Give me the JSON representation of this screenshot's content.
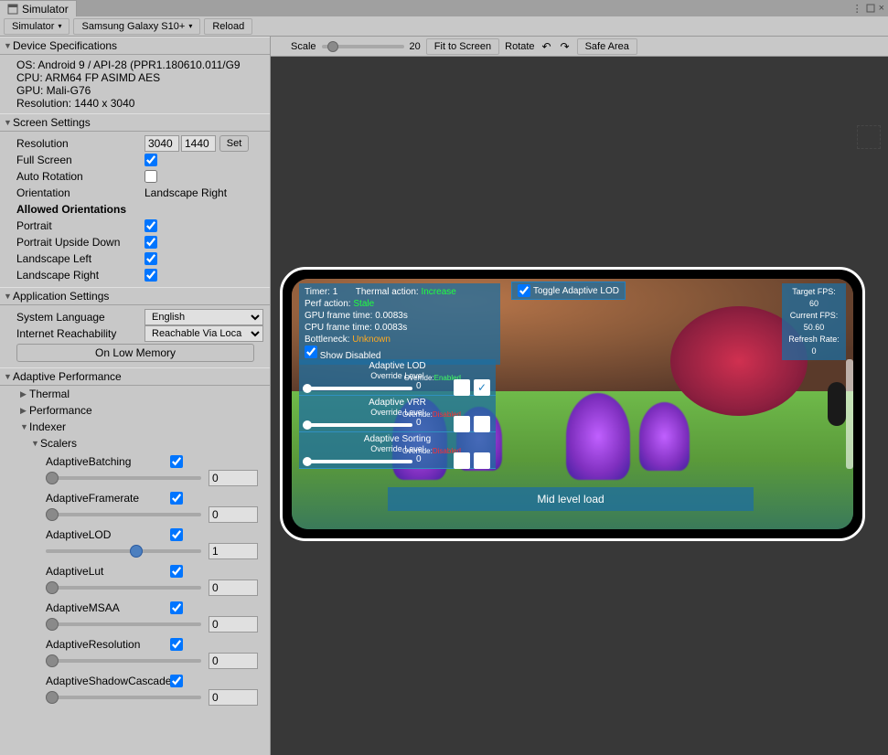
{
  "window": {
    "tab_title": "Simulator",
    "menu_icon": "⋮",
    "close_icon": "×"
  },
  "toolbar": {
    "simulator": "Simulator",
    "device": "Samsung Galaxy S10+",
    "reload": "Reload"
  },
  "devspec": {
    "title": "Device Specifications",
    "os": "OS: Android 9 / API-28 (PPR1.180610.011/G9",
    "cpu": "CPU: ARM64 FP ASIMD AES",
    "gpu": "GPU: Mali-G76",
    "res": "Resolution: 1440 x 3040"
  },
  "screen": {
    "title": "Screen Settings",
    "resolution_lbl": "Resolution",
    "res_w": "3040",
    "res_h": "1440",
    "set": "Set",
    "fullscreen_lbl": "Full Screen",
    "autorot_lbl": "Auto Rotation",
    "orientation_lbl": "Orientation",
    "orientation_val": "Landscape Right",
    "allowed_lbl": "Allowed Orientations",
    "portrait": "Portrait",
    "portrait_ud": "Portrait Upside Down",
    "landscape_l": "Landscape Left",
    "landscape_r": "Landscape Right"
  },
  "app": {
    "title": "Application Settings",
    "syslang_lbl": "System Language",
    "syslang_val": "English",
    "netreach_lbl": "Internet Reachability",
    "netreach_val": "Reachable Via Loca",
    "lowmem": "On Low Memory"
  },
  "ap": {
    "title": "Adaptive Performance",
    "thermal": "Thermal",
    "performance": "Performance",
    "indexer": "Indexer",
    "scalers": "Scalers",
    "scaler_items": [
      {
        "name": "AdaptiveBatching",
        "checked": true,
        "val": "0",
        "thumb": 0
      },
      {
        "name": "AdaptiveFramerate",
        "checked": true,
        "val": "0",
        "thumb": 0
      },
      {
        "name": "AdaptiveLOD",
        "checked": true,
        "val": "1",
        "thumb": 92,
        "blue": true
      },
      {
        "name": "AdaptiveLut",
        "checked": true,
        "val": "0",
        "thumb": 0
      },
      {
        "name": "AdaptiveMSAA",
        "checked": true,
        "val": "0",
        "thumb": 0
      },
      {
        "name": "AdaptiveResolution",
        "checked": true,
        "val": "0",
        "thumb": 0
      },
      {
        "name": "AdaptiveShadowCascade",
        "checked": true,
        "val": "0",
        "thumb": 0
      }
    ]
  },
  "viewport": {
    "scale_lbl": "Scale",
    "scale_val": "20",
    "fit": "Fit to Screen",
    "rotate": "Rotate",
    "safearea": "Safe Area"
  },
  "overlay_info": {
    "timer": "Timer: 1",
    "therm_lbl": "Thermal action:",
    "therm_val": "Increase",
    "perf_lbl": "Perf action:",
    "perf_val": "Stale",
    "gpu": "GPU frame time: 0.0083s",
    "cpu": "CPU frame time: 0.0083s",
    "bottle_lbl": "Bottleneck:",
    "bottle_val": "Unknown",
    "showdis": "Show Disabled"
  },
  "overlay_toggle": "Toggle Adaptive LOD",
  "overlay_fps": {
    "l1": "Target FPS:",
    "v1": "60",
    "l2": "Current  FPS:",
    "v2": "50.60",
    "l3": "Refresh Rate:",
    "v3": "0"
  },
  "overlay_controls": [
    {
      "title": "Adaptive LOD",
      "sub": "Override Level",
      "ov": "Override:",
      "state": "Enabled",
      "val": "0",
      "chk": true
    },
    {
      "title": "Adaptive VRR",
      "sub": "Override Level",
      "ov": "Override:",
      "state": "Disabled",
      "val": "0",
      "chk": false
    },
    {
      "title": "Adaptive Sorting",
      "sub": "Override Level",
      "ov": "Override:",
      "state": "Disabled",
      "val": "0",
      "chk": false
    }
  ],
  "overlay_midload": "Mid level load"
}
